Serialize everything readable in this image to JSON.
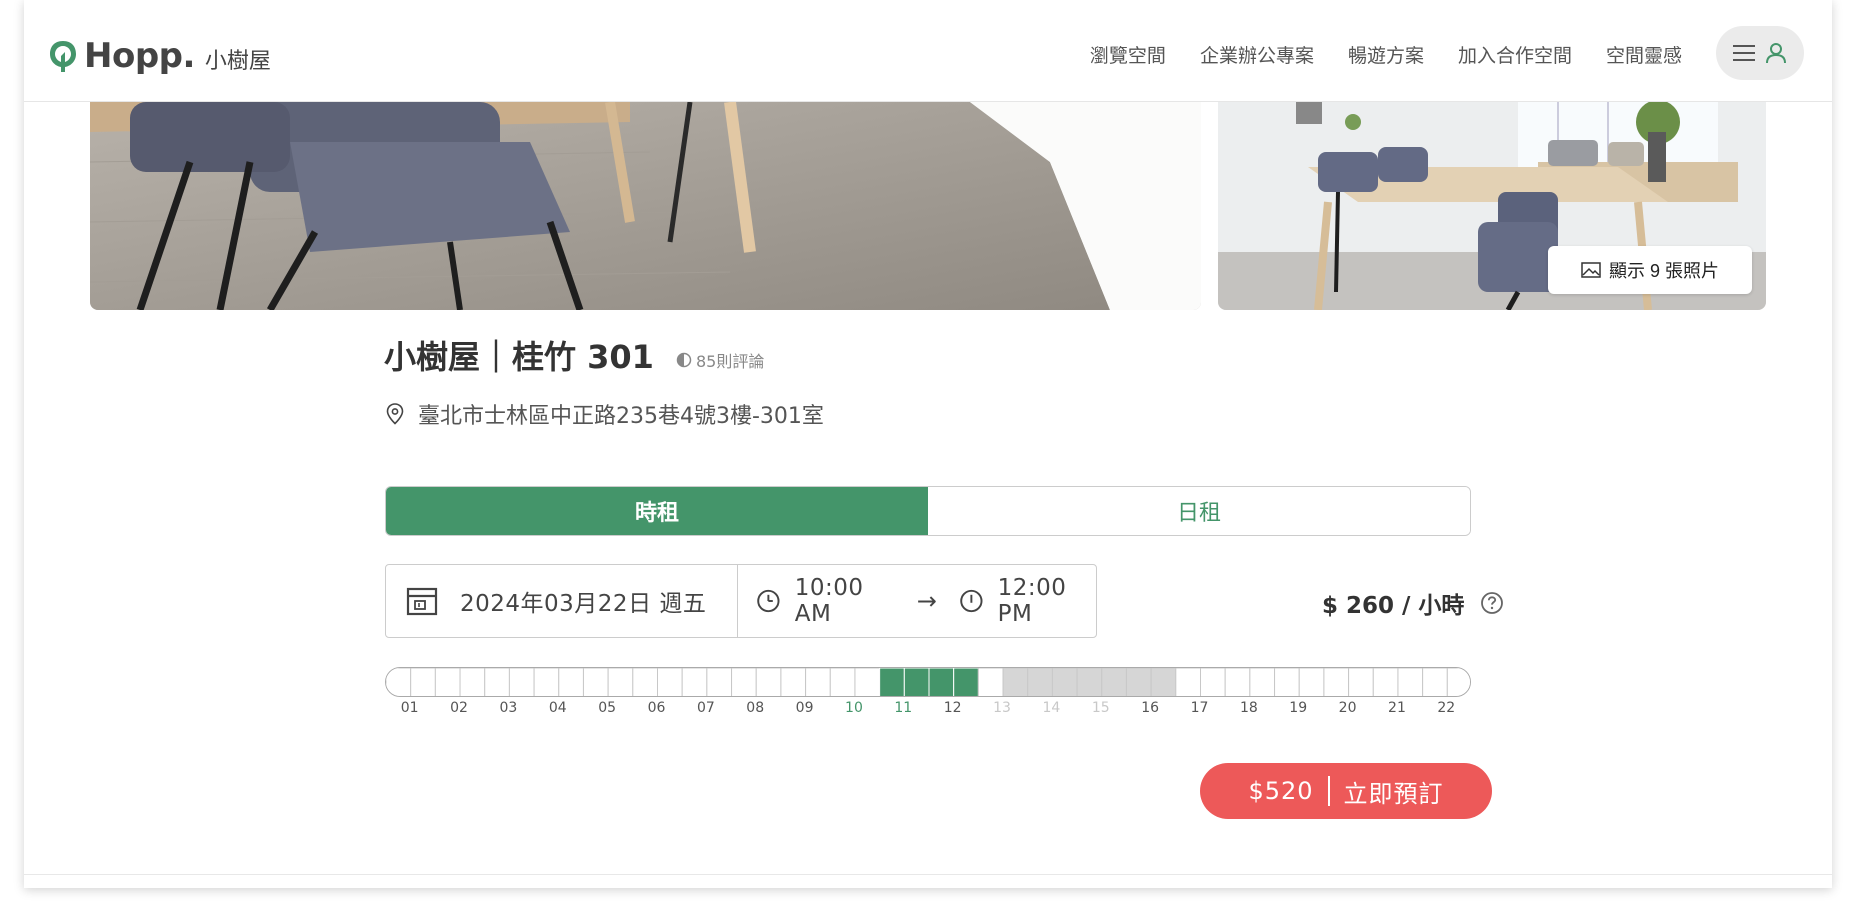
{
  "header": {
    "logo_text": "Hopp.",
    "logo_subtitle": "小樹屋",
    "nav": [
      "瀏覽空間",
      "企業辦公專案",
      "暢遊方案",
      "加入合作空間",
      "空間靈感"
    ]
  },
  "photos": {
    "show_all_label": "顯示 9 張照片"
  },
  "listing": {
    "title": "小樹屋｜桂竹 301",
    "reviews": "85則評論",
    "address": "臺北市士林區中正路235巷4號3樓-301室"
  },
  "tabs": {
    "hourly": "時租",
    "daily": "日租"
  },
  "booking": {
    "date": "2024年03月22日 週五",
    "start_time": "10:00 AM",
    "arrow": "→",
    "end_time": "12:00 PM",
    "price": "$ 260 / 小時"
  },
  "timeline": {
    "hours": [
      "01",
      "02",
      "03",
      "04",
      "05",
      "06",
      "07",
      "08",
      "09",
      "10",
      "11",
      "12",
      "13",
      "14",
      "15",
      "16",
      "17",
      "18",
      "19",
      "20",
      "21",
      "22"
    ],
    "selected_hours": [
      "10",
      "11"
    ],
    "unavailable_hours": [
      "13",
      "14",
      "15"
    ]
  },
  "cta": {
    "amount": "$520",
    "label": "立即預訂"
  },
  "colors": {
    "brand_green": "#44956a",
    "cta_red": "#ed5959",
    "unavailable_gray": "#d6d6d6"
  }
}
